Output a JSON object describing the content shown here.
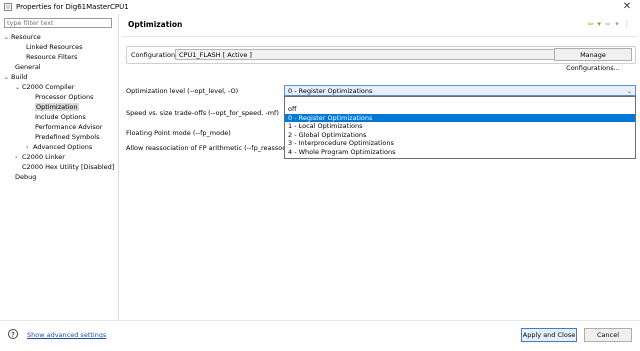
{
  "window": {
    "title": "Properties for Dig61MasterCPU1",
    "close_glyph": "✕",
    "icons": {
      "app": "properties-app-icon",
      "close": "close-icon"
    }
  },
  "left_pane": {
    "filter_placeholder": "type filter text",
    "tree": [
      {
        "label": "Resource",
        "expander": "⌄"
      },
      {
        "label": "Linked Resources"
      },
      {
        "label": "Resource Filters"
      },
      {
        "label": "General"
      },
      {
        "label": "Build",
        "expander": "⌄"
      },
      {
        "label": "C2000 Compiler",
        "expander": "⌄"
      },
      {
        "label": "Processor Options"
      },
      {
        "label": "Optimization",
        "selected": true
      },
      {
        "label": "Include Options"
      },
      {
        "label": "Performance Advisor"
      },
      {
        "label": "Predefined Symbols"
      },
      {
        "label": "Advanced Options",
        "expander": "›"
      },
      {
        "label": "C2000 Linker",
        "expander": "›"
      },
      {
        "label": "C2000 Hex Utility  [Disabled]"
      },
      {
        "label": "Debug"
      }
    ]
  },
  "header": {
    "title": "Optimization",
    "nav_back": "⇦ ▾",
    "nav_forward": "⇨ ▾",
    "nav_menu": "⋮"
  },
  "configuration": {
    "label": "Configuration:",
    "value": "CPU1_FLASH  [ Active ]",
    "dropdown_glyph": "⌄",
    "manage_button": "Manage Configurations..."
  },
  "options": {
    "labels": [
      "Optimization level (--opt_level, -O)",
      "Speed vs. size trade-offs (--opt_for_speed, -mf)",
      "Floating Point mode (--fp_mode)",
      "Allow reassociation of FP arithmetic (--fp_reassoc)"
    ],
    "opt_level_value": "0 - Register Optimizations",
    "dropdown_glyph": "⌄",
    "dropdown_items": [
      "off",
      "0 - Register Optimizations",
      "1 - Local Optimizations",
      "2 - Global Optimizations",
      "3 - Interprocedure Optimizations",
      "4 - Whole Program Optimizations"
    ],
    "dropdown_selected_index": 1
  },
  "footer": {
    "help_glyph": "?",
    "show_advanced": "Show advanced settings",
    "apply_close": "Apply and Close",
    "cancel": "Cancel",
    "icons": {
      "help": "help-icon"
    }
  },
  "colors": {
    "selection": "#0078d7",
    "link": "#1a4fa8",
    "nav_arrow": "#c77800"
  }
}
